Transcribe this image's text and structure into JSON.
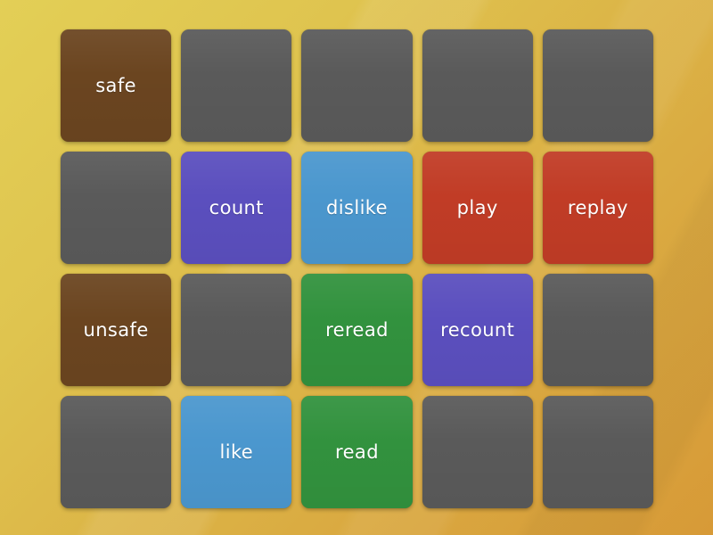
{
  "game": {
    "type": "matching-pairs-memory-game",
    "grid": {
      "columns": 5,
      "rows": 4,
      "total_tiles": 20
    },
    "background": {
      "gradient_start": "#e3cf56",
      "gradient_end": "#d79a37",
      "direction": "diagonal-top-left-to-bottom-right"
    },
    "colors": {
      "facedown": "#5a5a5a",
      "brown": "#6b4520",
      "purple": "#5b4fbe",
      "blue": "#4b97ce",
      "red": "#c13c26",
      "green": "#32923e",
      "label": "#ffffff"
    },
    "tiles": [
      {
        "index": 0,
        "row": 1,
        "col": 1,
        "label": "safe",
        "color": "#6b4520",
        "state": "revealed"
      },
      {
        "index": 1,
        "row": 1,
        "col": 2,
        "label": "",
        "color": "#5a5a5a",
        "state": "facedown"
      },
      {
        "index": 2,
        "row": 1,
        "col": 3,
        "label": "",
        "color": "#5a5a5a",
        "state": "facedown"
      },
      {
        "index": 3,
        "row": 1,
        "col": 4,
        "label": "",
        "color": "#5a5a5a",
        "state": "facedown"
      },
      {
        "index": 4,
        "row": 1,
        "col": 5,
        "label": "",
        "color": "#5a5a5a",
        "state": "facedown"
      },
      {
        "index": 5,
        "row": 2,
        "col": 1,
        "label": "",
        "color": "#5a5a5a",
        "state": "facedown"
      },
      {
        "index": 6,
        "row": 2,
        "col": 2,
        "label": "count",
        "color": "#5b4fbe",
        "state": "revealed"
      },
      {
        "index": 7,
        "row": 2,
        "col": 3,
        "label": "dislike",
        "color": "#4b97ce",
        "state": "revealed"
      },
      {
        "index": 8,
        "row": 2,
        "col": 4,
        "label": "play",
        "color": "#c13c26",
        "state": "revealed"
      },
      {
        "index": 9,
        "row": 2,
        "col": 5,
        "label": "replay",
        "color": "#c13c26",
        "state": "revealed"
      },
      {
        "index": 10,
        "row": 3,
        "col": 1,
        "label": "unsafe",
        "color": "#6b4520",
        "state": "revealed"
      },
      {
        "index": 11,
        "row": 3,
        "col": 2,
        "label": "",
        "color": "#5a5a5a",
        "state": "facedown"
      },
      {
        "index": 12,
        "row": 3,
        "col": 3,
        "label": "reread",
        "color": "#32923e",
        "state": "revealed"
      },
      {
        "index": 13,
        "row": 3,
        "col": 4,
        "label": "recount",
        "color": "#5b4fbe",
        "state": "revealed"
      },
      {
        "index": 14,
        "row": 3,
        "col": 5,
        "label": "",
        "color": "#5a5a5a",
        "state": "facedown"
      },
      {
        "index": 15,
        "row": 4,
        "col": 1,
        "label": "",
        "color": "#5a5a5a",
        "state": "facedown"
      },
      {
        "index": 16,
        "row": 4,
        "col": 2,
        "label": "like",
        "color": "#4b97ce",
        "state": "revealed"
      },
      {
        "index": 17,
        "row": 4,
        "col": 3,
        "label": "read",
        "color": "#32923e",
        "state": "revealed"
      },
      {
        "index": 18,
        "row": 4,
        "col": 4,
        "label": "",
        "color": "#5a5a5a",
        "state": "facedown"
      },
      {
        "index": 19,
        "row": 4,
        "col": 5,
        "label": "",
        "color": "#5a5a5a",
        "state": "facedown"
      }
    ]
  }
}
